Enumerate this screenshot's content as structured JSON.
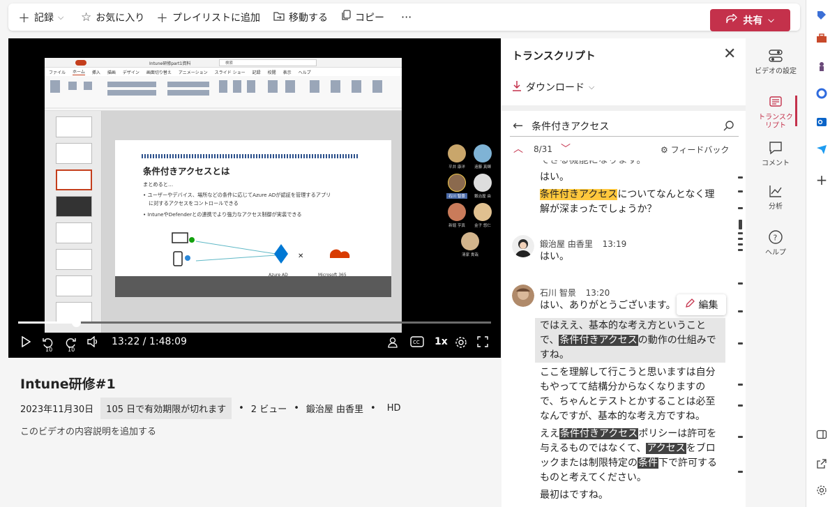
{
  "toolbar": {
    "record": "記録",
    "favorite": "お気に入り",
    "add_playlist": "プレイリストに追加",
    "move": "移動する",
    "copy": "コピー",
    "more": "···",
    "share": "共有"
  },
  "video": {
    "time": "13:22 / 1:48:09",
    "speed": "1x",
    "progress_fraction": 0.123,
    "rewind_label": "10",
    "forward_label": "10",
    "slide": {
      "title": "条件付きアクセスとは",
      "intro": "まとめると…",
      "bullet1_a": "• ユーザーやデバイス、場所などの条件に応じてAzure ADが認証を管理するアプリ",
      "bullet1_b": "に対するアクセスをコントロールできる",
      "bullet2": "• IntuneやDefenderとの連携でより強力なアクセス制御が実装できる",
      "node_azure": "Azure AD",
      "node_m365": "Microsoft 365"
    },
    "window_title": "Intune研修part1資料",
    "search_label": "検索",
    "ribbon_tabs": [
      "ファイル",
      "ホーム",
      "挿入",
      "描画",
      "デザイン",
      "画面切り替え",
      "アニメーション",
      "スライド ショー",
      "記録",
      "校閲",
      "表示",
      "ヘルプ"
    ],
    "participants": [
      "平井 康洋",
      "遠藤 真輝",
      "石川 智景",
      "鍛治屋 由",
      "新堀 亨真",
      "金子 悠仁",
      "清家 貴哉"
    ]
  },
  "info": {
    "title": "Intune研修#1",
    "date": "2023年11月30日",
    "expiry": "105 日で有効期限が切れます",
    "views": "2 ビュー",
    "owner": "鍛治屋 由香里",
    "quality": "HD",
    "sep": "•",
    "add_description": "このビデオの内容説明を追加する"
  },
  "transcript": {
    "heading": "トランスクリプト",
    "download": "ダウンロード",
    "search_value": "条件付きアクセス",
    "match_count": "8/31",
    "feedback": "フィードバック",
    "cut_line": "できる機能になります。",
    "lines_block1": [
      "はい。"
    ],
    "hl_term": "条件付きアクセス",
    "hl_rest": "についてなんとなく理",
    "block1_end": "解が深まったでしょうか？",
    "speaker2": "鍛治屋 由香里",
    "time2": "13:19",
    "text2": "はい。",
    "speaker3": "石川 智景",
    "time3": "13:20",
    "text3": "はい、ありがとうございます。",
    "edit": "編集",
    "sel_line1": "ではええ、基本的な考え方ということ",
    "sel_line2_a": "で、",
    "sel_line2_term": "条件付きアクセス",
    "sel_line2_b": "の動作の仕組みで",
    "sel_line3": "すね。",
    "p2": [
      "ここを理解して行こうと思いますは自分",
      "もやってて結構分からなくなりますの",
      "で、ちゃんとテストとかすることは必至",
      "なんですが、基本的な考え方ですね。"
    ],
    "p3_a": "ええ",
    "p3_term": "条件付きアクセス",
    "p3_b": "ポリシーは許可を",
    "p3_l2_a": "与えるものではなくて、",
    "p3_l2_term": "アクセス",
    "p3_l2_b": "をブロ",
    "p3_l3_a": "ックまたは制限特定の",
    "p3_l3_term": "条件",
    "p3_l3_b": "下で許可する",
    "p3_l4": "ものと考えてください。",
    "last": "最初はですね。"
  },
  "rail": {
    "video_settings": "ビデオの設定",
    "transcript": "トランスクリプト",
    "comments": "コメント",
    "analytics": "分析",
    "help": "ヘルプ"
  },
  "colors": {
    "accent": "#c4314b",
    "highlight": "#ffc83d"
  }
}
